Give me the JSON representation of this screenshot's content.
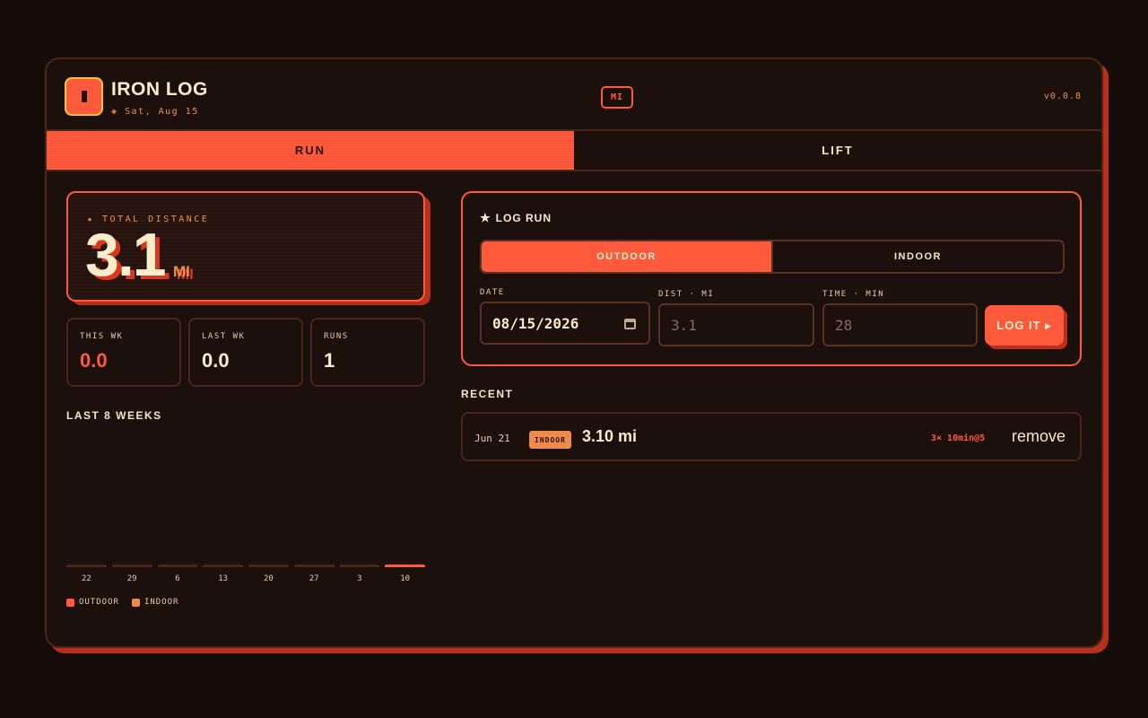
{
  "header": {
    "title": "IRON LOG",
    "date": "◈ Sat, Aug 15",
    "unit_chip": "MI",
    "version": "v0.0.8"
  },
  "tabs": [
    {
      "label": "RUN",
      "active": true
    },
    {
      "label": "LIFT",
      "active": false
    }
  ],
  "total": {
    "label": "★ TOTAL DISTANCE",
    "value": "3.1",
    "unit": "MI"
  },
  "stats": [
    {
      "label": "THIS WK",
      "value": "0.0",
      "color": "#ff5a3c"
    },
    {
      "label": "LAST WK",
      "value": "0.0",
      "color": "#fdeccb"
    },
    {
      "label": "RUNS",
      "value": "1",
      "color": "#fdeccb"
    }
  ],
  "chart_section_title": "LAST 8 WEEKS",
  "chart_data": {
    "type": "bar",
    "categories": [
      "22",
      "29",
      "6",
      "13",
      "20",
      "27",
      "3",
      "10"
    ],
    "series": [
      {
        "name": "OUTDOOR",
        "color": "#ff5a3c",
        "values": [
          0,
          0,
          0,
          0,
          0,
          0,
          0,
          0
        ]
      },
      {
        "name": "INDOOR",
        "color": "#f08a4b",
        "values": [
          0,
          0,
          0,
          0,
          0,
          0,
          0,
          0
        ]
      }
    ],
    "highlight_index": 7
  },
  "legend": [
    {
      "label": "OUTDOOR",
      "color": "#ff5a3c"
    },
    {
      "label": "INDOOR",
      "color": "#f08a4b"
    }
  ],
  "log_run": {
    "title": "LOG RUN",
    "modes": [
      {
        "label": "OUTDOOR",
        "active": true
      },
      {
        "label": "INDOOR",
        "active": false
      }
    ],
    "date_label": "DATE",
    "date_value": "08/15/2026",
    "dist_label": "DIST · MI",
    "dist_placeholder": "3.1",
    "time_label": "TIME · MIN",
    "time_placeholder": "28",
    "submit_label": "LOG IT ▸"
  },
  "recent_title": "RECENT",
  "recent": [
    {
      "date": "Jun 21",
      "badge": "INDOOR",
      "distance": "3.10 mi",
      "sets": "3× 10min@5",
      "remove_label": "remove"
    }
  ]
}
